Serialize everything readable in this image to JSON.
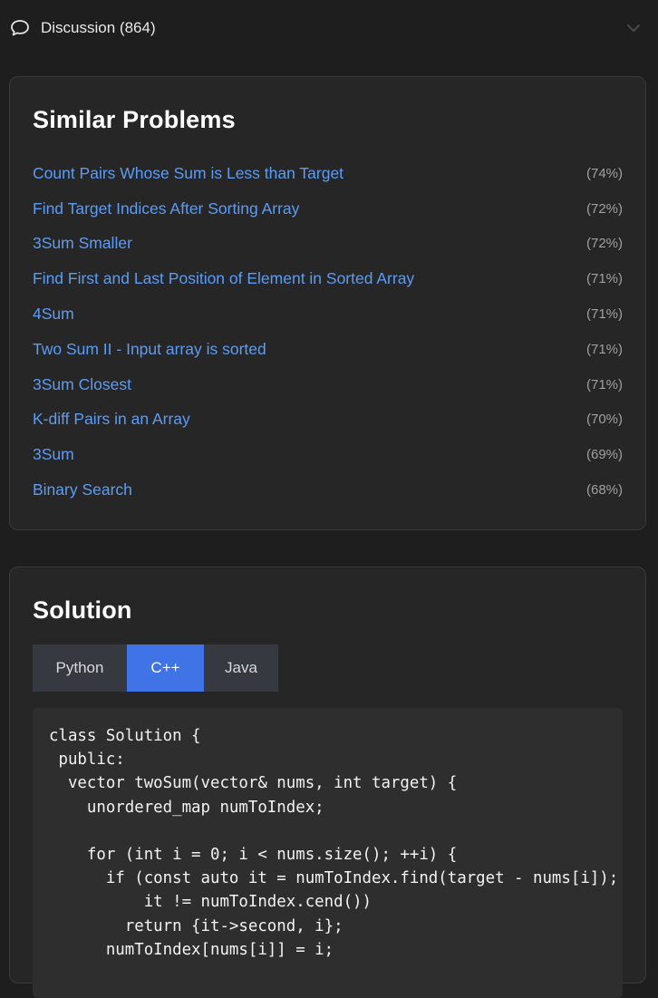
{
  "discussion": {
    "label": "Discussion (864)"
  },
  "similar": {
    "title": "Similar Problems",
    "items": [
      {
        "name": "Count Pairs Whose Sum is Less than Target",
        "pct": "(74%)"
      },
      {
        "name": "Find Target Indices After Sorting Array",
        "pct": "(72%)"
      },
      {
        "name": "3Sum Smaller",
        "pct": "(72%)"
      },
      {
        "name": "Find First and Last Position of Element in Sorted Array",
        "pct": "(71%)"
      },
      {
        "name": "4Sum",
        "pct": "(71%)"
      },
      {
        "name": "Two Sum II - Input array is sorted",
        "pct": "(71%)"
      },
      {
        "name": "3Sum Closest",
        "pct": "(71%)"
      },
      {
        "name": "K-diff Pairs in an Array",
        "pct": "(70%)"
      },
      {
        "name": "3Sum",
        "pct": "(69%)"
      },
      {
        "name": "Binary Search",
        "pct": "(68%)"
      }
    ]
  },
  "solution": {
    "title": "Solution",
    "tabs": [
      "Python",
      "C++",
      "Java"
    ],
    "code": [
      "class Solution {",
      " public:",
      "  vector twoSum(vector& nums, int target) {",
      "    unordered_map numToIndex;",
      "",
      "    for (int i = 0; i < nums.size(); ++i) {",
      "      if (const auto it = numToIndex.find(target - nums[i]);",
      "          it != numToIndex.cend())",
      "        return {it->second, i};",
      "      numToIndex[nums[i]] = i;"
    ]
  },
  "colors": {
    "accent": "#3f73e6",
    "link": "#5c9cf5"
  },
  "icons": {
    "discussion": "speech-bubble-icon",
    "collapse": "chevron-down-icon"
  }
}
